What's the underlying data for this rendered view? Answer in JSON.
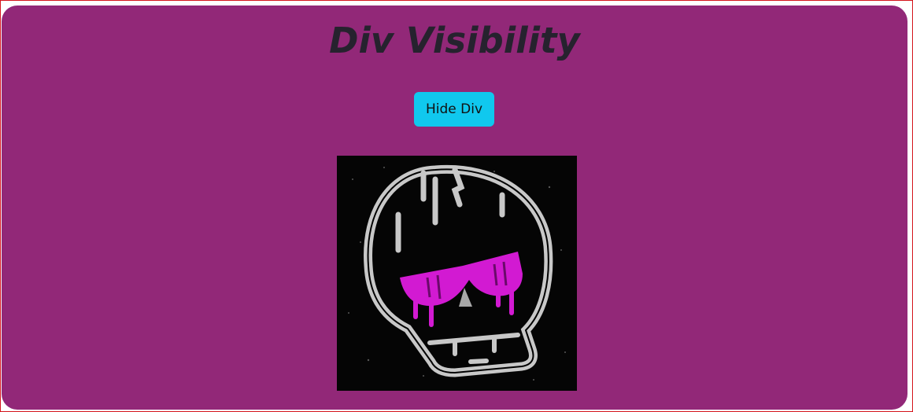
{
  "page": {
    "title": "Div Visibility"
  },
  "toggle_button": {
    "label": "Hide Div"
  },
  "image": {
    "subject": "skull-with-sunglasses",
    "colors": {
      "background": "#050505",
      "outline": "#c8c8c8",
      "glasses": "#d21ad2"
    }
  },
  "theme": {
    "panel_bg": "#922878",
    "title_color": "#26222e",
    "button_bg": "#10c8ee",
    "frame_border": "#d4141c"
  }
}
